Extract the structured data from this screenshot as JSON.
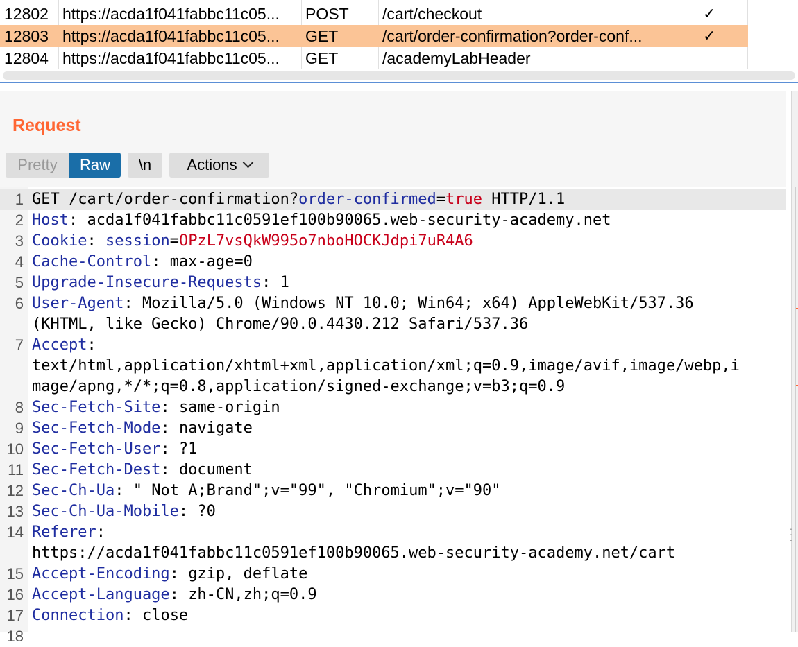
{
  "history": {
    "rows": [
      {
        "num": "12802",
        "host": "https://acda1f041fabbc11c05...",
        "method": "POST",
        "url": "/cart/checkout",
        "check": "✓",
        "selected": false
      },
      {
        "num": "12803",
        "host": "https://acda1f041fabbc11c05...",
        "method": "GET",
        "url": "/cart/order-confirmation?order-conf...",
        "check": "✓",
        "selected": true
      },
      {
        "num": "12804",
        "host": "https://acda1f041fabbc11c05...",
        "method": "GET",
        "url": "/academyLabHeader",
        "check": "",
        "selected": false
      }
    ]
  },
  "request": {
    "title": "Request",
    "tabs": {
      "pretty": "Pretty",
      "raw": "Raw",
      "newline": "\\n",
      "actions": "Actions"
    },
    "lines": [
      {
        "n": "1",
        "method": "GET /cart/order-confirmation?",
        "pname": "order-confirmed",
        "eq": "=",
        "pval": "true",
        "tail": " HTTP/1.1"
      },
      {
        "n": "2",
        "key": "Host",
        "val": "acda1f041fabbc11c0591ef100b90065.web-security-academy.net"
      },
      {
        "n": "3",
        "key": "Cookie",
        "pname": "session",
        "pval": "OPzL7vsQkW995o7nboHOCKJdpi7uR4A6"
      },
      {
        "n": "4",
        "key": "Cache-Control",
        "val": "max-age=0"
      },
      {
        "n": "5",
        "key": "Upgrade-Insecure-Requests",
        "val": "1"
      },
      {
        "n": "6",
        "key": "User-Agent",
        "val": "Mozilla/5.0 (Windows NT 10.0; Win64; x64) AppleWebKit/537.36",
        "cont": "(KHTML, like Gecko) Chrome/90.0.4430.212 Safari/537.36"
      },
      {
        "n": "7",
        "key": "Accept",
        "val": "",
        "cont": "text/html,application/xhtml+xml,application/xml;q=0.9,image/avif,image/webp,i",
        "cont2": "mage/apng,*/*;q=0.8,application/signed-exchange;v=b3;q=0.9"
      },
      {
        "n": "8",
        "key": "Sec-Fetch-Site",
        "val": "same-origin"
      },
      {
        "n": "9",
        "key": "Sec-Fetch-Mode",
        "val": "navigate"
      },
      {
        "n": "10",
        "key": "Sec-Fetch-User",
        "val": "?1"
      },
      {
        "n": "11",
        "key": "Sec-Fetch-Dest",
        "val": "document"
      },
      {
        "n": "12",
        "key": "Sec-Ch-Ua",
        "val": "\" Not A;Brand\";v=\"99\", \"Chromium\";v=\"90\""
      },
      {
        "n": "13",
        "key": "Sec-Ch-Ua-Mobile",
        "val": "?0"
      },
      {
        "n": "14",
        "key": "Referer",
        "val": "",
        "cont": "https://acda1f041fabbc11c0591ef100b90065.web-security-academy.net/cart"
      },
      {
        "n": "15",
        "key": "Accept-Encoding",
        "val": "gzip, deflate"
      },
      {
        "n": "16",
        "key": "Accept-Language",
        "val": "zh-CN,zh;q=0.9"
      },
      {
        "n": "17",
        "key": "Connection",
        "val": "close"
      },
      {
        "n": "18"
      }
    ]
  },
  "colors": {
    "accent": "#ff6633",
    "selected_row": "#fbc496",
    "raw_tab": "#1a6ea8",
    "header_key": "#1f2da0",
    "param_value": "#c8001a"
  }
}
